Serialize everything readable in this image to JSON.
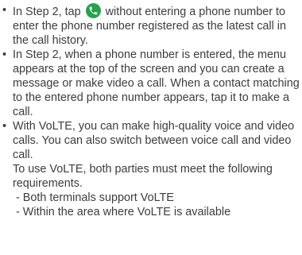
{
  "notes": {
    "note1": {
      "before_icon": "In Step 2, tap",
      "icon": "phone-call-icon",
      "after_icon": " without entering a phone number to enter the phone number registered as the latest call in the call history."
    },
    "note2": {
      "text": "In Step 2, when a phone number is entered, the menu appears at the top of the screen and you can create a message or make video a call. When a contact matching to the entered phone number appears, tap it to make a call."
    },
    "note3": {
      "line1": "With VoLTE, you can make high-quality voice and video calls. You can also switch between voice call and video call.",
      "line2": "To use VoLTE, both parties must meet the following requirements.",
      "req1": "- Both terminals support VoLTE",
      "req2": "- Within the area where VoLTE is available"
    }
  },
  "colors": {
    "icon_green": "#22a44a",
    "text": "#3c3c3c"
  }
}
